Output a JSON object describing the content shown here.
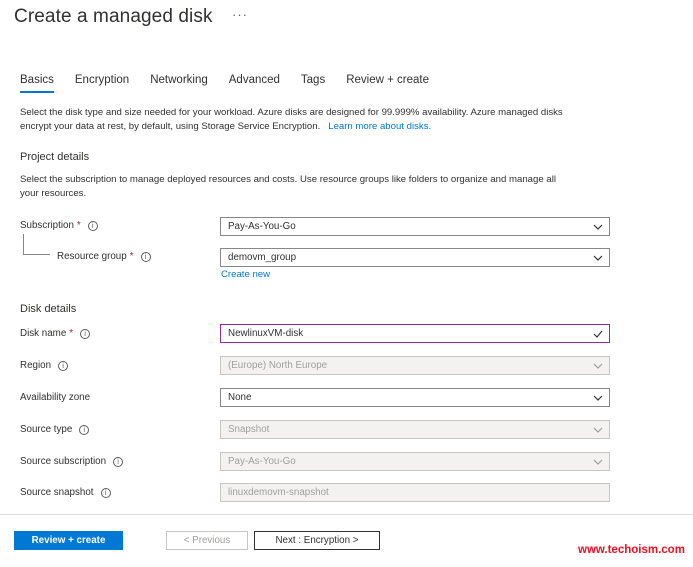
{
  "page": {
    "title": "Create a managed disk",
    "more": "···"
  },
  "tabs": [
    {
      "label": "Basics",
      "active": true
    },
    {
      "label": "Encryption"
    },
    {
      "label": "Networking"
    },
    {
      "label": "Advanced"
    },
    {
      "label": "Tags"
    },
    {
      "label": "Review + create"
    }
  ],
  "intro": {
    "line1": "Select the disk type and size needed for your workload. Azure disks are designed for 99.999% availability. Azure managed disks",
    "line2": "encrypt your data at rest, by default, using Storage Service Encryption.",
    "link": "Learn more about disks."
  },
  "project": {
    "heading": "Project details",
    "desc1": "Select the subscription to manage deployed resources and costs. Use resource groups like folders to organize and manage all",
    "desc2": "your resources.",
    "subscription_label": "Subscription",
    "subscription_value": "Pay-As-You-Go",
    "rg_label": "Resource group",
    "rg_value": "demovm_group",
    "create_new": "Create new"
  },
  "disk": {
    "heading": "Disk details",
    "name_label": "Disk name",
    "name_value": "NewlinuxVM-disk",
    "region_label": "Region",
    "region_value": "(Europe) North Europe",
    "az_label": "Availability zone",
    "az_value": "None",
    "source_type_label": "Source type",
    "source_type_value": "Snapshot",
    "source_sub_label": "Source subscription",
    "source_sub_value": "Pay-As-You-Go",
    "source_snap_label": "Source snapshot",
    "source_snap_value": "linuxdemovm-snapshot"
  },
  "required_mark": "*",
  "info_glyph": "i",
  "buttons": {
    "review": "Review + create",
    "previous": "< Previous",
    "next": "Next : Encryption >"
  },
  "watermark": "www.techoism.com",
  "colors": {
    "accent": "#0078d4",
    "required": "#a4262c",
    "focus_border": "#8a2da5",
    "watermark": "#e81123"
  }
}
